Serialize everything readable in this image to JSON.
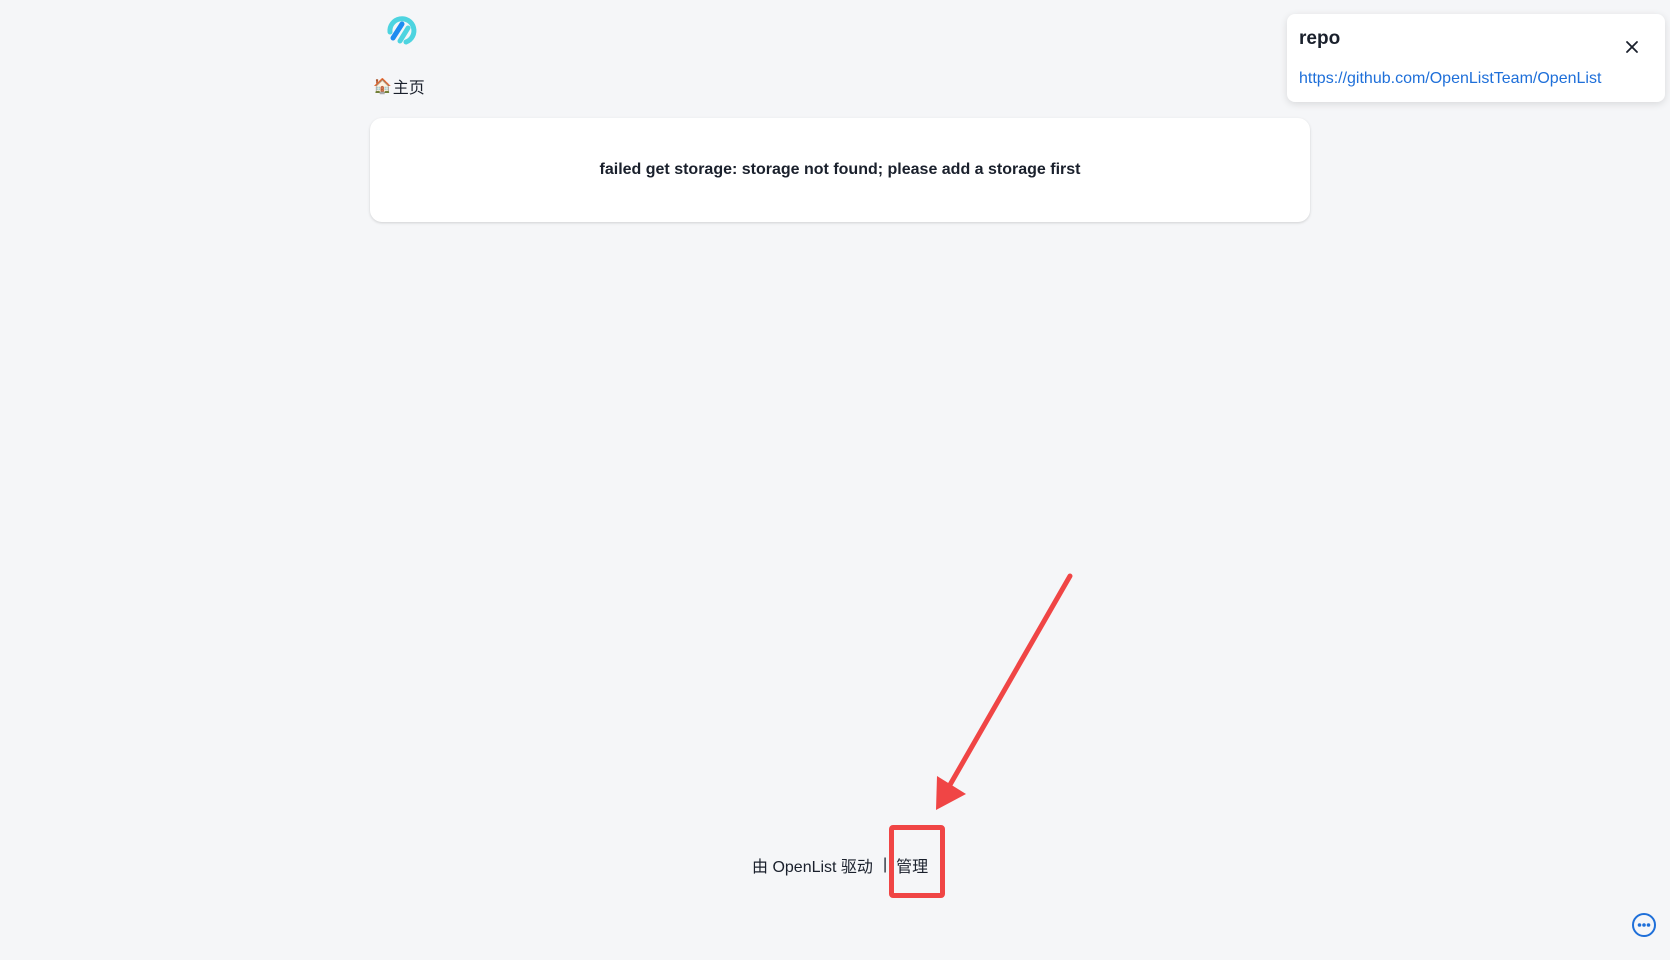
{
  "header": {
    "logo_icon": "openlist-logo-icon",
    "breadcrumb": {
      "home_icon": "🏠",
      "home_label": "主页"
    }
  },
  "main": {
    "error_message": "failed get storage: storage not found; please add a storage first"
  },
  "notification": {
    "title": "repo",
    "link": "https://github.com/OpenListTeam/OpenList",
    "close_icon": "close-icon"
  },
  "footer": {
    "powered_by": "由 OpenList 驱动",
    "separator": "|",
    "manage_label": "管理"
  },
  "annotation": {
    "color": "#f04545"
  },
  "colors": {
    "background": "#f5f6f8",
    "link": "#1e6fd9",
    "logo_primary": "#1d8cf0",
    "logo_secondary": "#4dd4e0"
  }
}
